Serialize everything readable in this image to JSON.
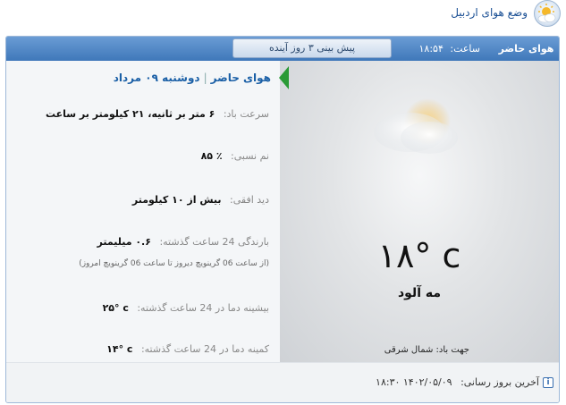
{
  "page": {
    "title": "وضع هوای اردبیل",
    "icon": "partly-cloudy-icon"
  },
  "tabs": {
    "current_label": "هوای حاضر",
    "clock_label": "ساعت:",
    "clock_time": "۱۸:۵۴",
    "forecast_label": "پیش بینی ۳ روز آینده"
  },
  "current": {
    "temperature": "١٨° c",
    "condition": "مه آلود",
    "wind_direction_label": "جهت باد:",
    "wind_direction_value": "شمال شرقی",
    "image_icon": "cloudy-sun-icon"
  },
  "details": {
    "header_title": "هوای حاضر",
    "header_date": "دوشنبه ۰۹ مرداد",
    "wind_speed_label": "سرعت باد:",
    "wind_speed_value": "۶ متر بر ثانیه، ۲۱ کیلومتر بر ساعت",
    "humidity_label": "نم نسبی:",
    "humidity_value": "٪ ۸۵",
    "visibility_label": "دید افقی:",
    "visibility_value": "بیش از ۱۰ کیلومتر",
    "rain_label": "بارندگی 24 ساعت گذشته:",
    "rain_value": "۰.۶ میلیمتر",
    "rain_note": "(از ساعت 06 گرینویچ دیروز تا ساعت 06 گرینویچ امروز)",
    "max_temp_label": "بیشینه دما در 24 ساعت گذشته:",
    "max_temp_value": "۲۵° c",
    "min_temp_label": "کمینه دما در 24 ساعت گذشته:",
    "min_temp_value": "۱۴° c"
  },
  "footer": {
    "last_update_label": "آخرین بروز رسانی:",
    "last_update_value": "۱۸:۳۰ ۱۴۰۲/۰۵/۰۹",
    "icon": "info-icon"
  },
  "colors": {
    "tab_bar": "#4a83c4",
    "link_blue": "#1a5fa6",
    "pointer_green": "#2a9a36"
  }
}
